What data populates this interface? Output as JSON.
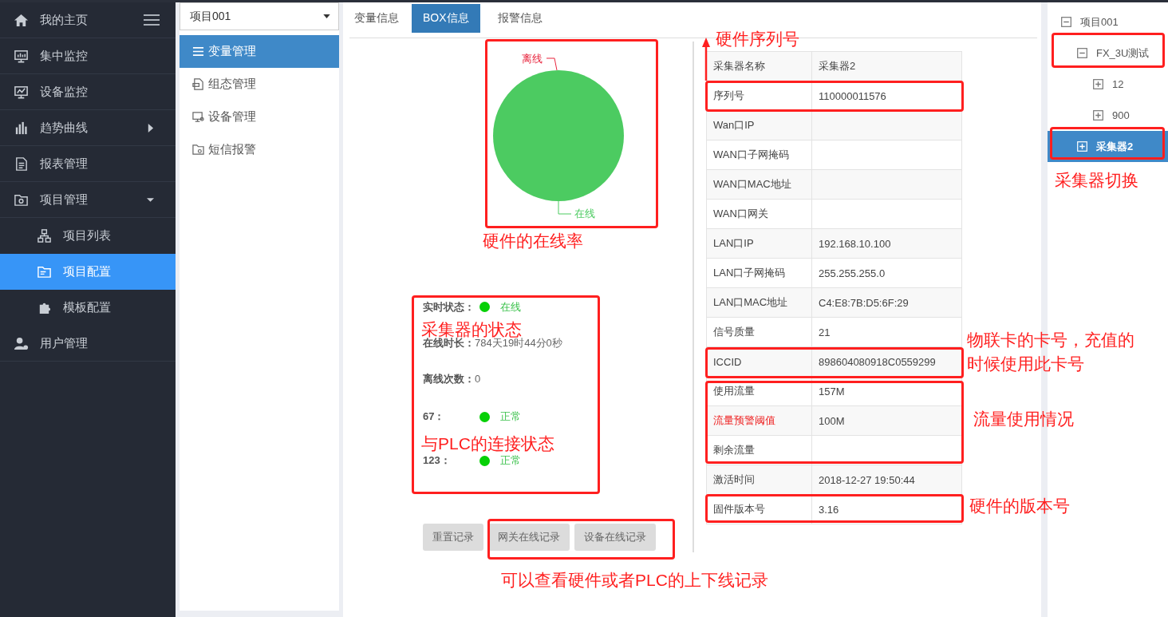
{
  "sidebar": {
    "items": [
      {
        "label": "我的主页",
        "selected": false
      },
      {
        "label": "集中监控",
        "selected": false
      },
      {
        "label": "设备监控",
        "selected": false
      },
      {
        "label": "趋势曲线",
        "selected": false,
        "expanded": false
      },
      {
        "label": "报表管理",
        "selected": false
      },
      {
        "label": "项目管理",
        "selected": false,
        "expanded": true,
        "children": [
          {
            "label": "项目列表",
            "selected": false
          },
          {
            "label": "项目配置",
            "selected": true
          },
          {
            "label": "模板配置",
            "selected": false
          }
        ]
      },
      {
        "label": "用户管理",
        "selected": false
      }
    ]
  },
  "project_select": {
    "value": "项目001"
  },
  "submenu": [
    {
      "label": "变量管理",
      "selected": true
    },
    {
      "label": "组态管理",
      "selected": false
    },
    {
      "label": "设备管理",
      "selected": false
    },
    {
      "label": "短信报警",
      "selected": false
    }
  ],
  "tabs": [
    {
      "label": "变量信息",
      "selected": false
    },
    {
      "label": "BOX信息",
      "selected": true
    },
    {
      "label": "报警信息",
      "selected": false
    }
  ],
  "online_chart": {
    "labels": [
      {
        "text": "离线",
        "color": "#e8253d"
      },
      {
        "text": "在线",
        "color": "#4ccb61"
      }
    ]
  },
  "status": [
    {
      "kind": "dot",
      "label": "实时状态：",
      "value": "在线"
    },
    {
      "kind": "text",
      "label": "在线时长：",
      "value": "784天19时44分0秒"
    },
    {
      "kind": "text",
      "label": "离线次数：",
      "value": "0"
    },
    {
      "kind": "dot",
      "label": "67：",
      "value": "正常"
    },
    {
      "kind": "dot",
      "label": "123：",
      "value": "正常"
    }
  ],
  "buttons": [
    "重置记录",
    "网关在线记录",
    "设备在线记录"
  ],
  "info_table": [
    {
      "label": "采集器名称",
      "value": "采集器2",
      "warning": false
    },
    {
      "label": "序列号",
      "value": "110000011576",
      "warning": false
    },
    {
      "label": "Wan口IP",
      "warning": false
    },
    {
      "label": "WAN口子网掩码",
      "warning": false
    },
    {
      "label": "WAN口MAC地址",
      "warning": false
    },
    {
      "label": "WAN口网关",
      "warning": false
    },
    {
      "label": "LAN口IP",
      "value": "192.168.10.100",
      "warning": false
    },
    {
      "label": "LAN口子网掩码",
      "value": "255.255.255.0",
      "warning": false
    },
    {
      "label": "LAN口MAC地址",
      "value": "C4:E8:7B:D5:6F:29",
      "warning": false
    },
    {
      "label": "信号质量",
      "value": "21",
      "warning": false
    },
    {
      "label": "ICCID",
      "value": "898604080918C0559299",
      "warning": false
    },
    {
      "label": "使用流量",
      "value": "157M",
      "warning": false
    },
    {
      "label": "流量预警阈值",
      "value": "100M",
      "warning": true
    },
    {
      "label": "剩余流量",
      "warning": false
    },
    {
      "label": "激活时间",
      "value": "2018-12-27 19:50:44",
      "warning": false
    },
    {
      "label": "固件版本号",
      "value": "3.16",
      "warning": false
    }
  ],
  "tree": [
    {
      "label": "项目001",
      "expanded": true,
      "selected": false,
      "children": [
        {
          "label": "FX_3U测试",
          "expanded": true,
          "selected": false,
          "children": [
            {
              "label": "12",
              "expanded": false,
              "selected": false
            },
            {
              "label": "900",
              "expanded": false,
              "selected": false
            }
          ]
        },
        {
          "label": "采集器2",
          "expanded": false,
          "selected": true
        }
      ]
    }
  ],
  "annotations": [
    {
      "kind": "note",
      "text": "硬件序列号"
    },
    {
      "kind": "box"
    },
    {
      "kind": "arrow"
    },
    {
      "kind": "box"
    },
    {
      "kind": "box"
    },
    {
      "kind": "box"
    },
    {
      "kind": "note",
      "text": "采集器切换"
    },
    {
      "kind": "note",
      "text": "硬件的在线率"
    },
    {
      "kind": "box"
    },
    {
      "kind": "note",
      "text": "采集器的状态"
    },
    {
      "kind": "note",
      "text": "物联卡的卡号，充值的时候使用此卡号"
    },
    {
      "kind": "box"
    },
    {
      "kind": "box"
    },
    {
      "kind": "note",
      "text": "流量使用情况"
    },
    {
      "kind": "note",
      "text": "与PLC的连接状态"
    },
    {
      "kind": "box"
    },
    {
      "kind": "note",
      "text": "硬件的版本号"
    },
    {
      "kind": "box"
    },
    {
      "kind": "note",
      "text": "可以查看硬件或者PLC的上下线记录"
    }
  ]
}
